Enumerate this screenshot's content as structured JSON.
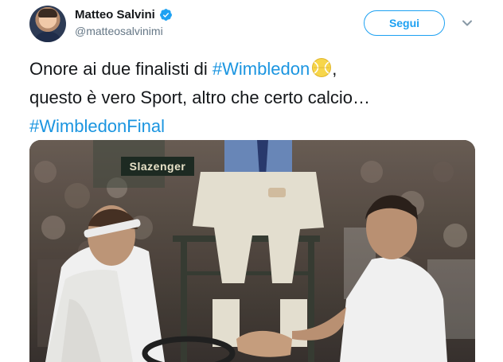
{
  "user": {
    "display_name": "Matteo Salvini",
    "handle": "@matteosalvinimi",
    "verified": true
  },
  "actions": {
    "follow_label": "Segui"
  },
  "tweet": {
    "line1_text": "Onore ai due finalisti di ",
    "line1_hashtag": "#Wimbledon",
    "line1_suffix": ",",
    "line2": "questo è vero Sport, altro che certo calcio…",
    "line3_hashtag": "#WimbledonFinal"
  },
  "media": {
    "sponsor_board": "Slazenger"
  },
  "colors": {
    "accent": "#1da1f2",
    "hashtag": "#1b95e0",
    "handle_gray": "#657786",
    "text": "#14171a"
  },
  "icons": {
    "verified": "verified-badge-icon",
    "caret": "chevron-down-icon",
    "emoji": "tennis-ball-emoji-icon"
  }
}
